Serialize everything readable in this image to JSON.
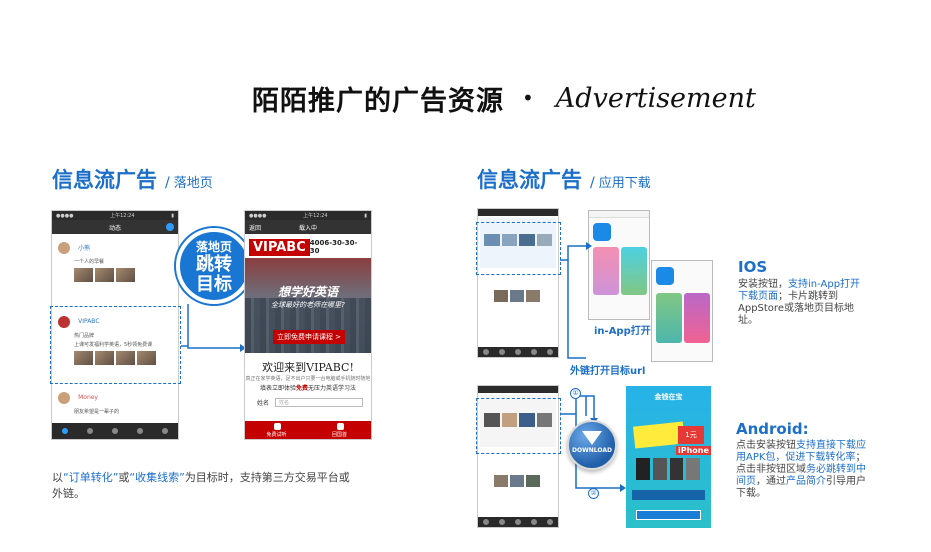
{
  "title": {
    "zh": "陌陌推广的广告资源",
    "dot": "•",
    "en": "Advertisement"
  },
  "left_section": {
    "heading": "信息流广告",
    "slash": "/",
    "subheading": "落地页",
    "badge": {
      "line1": "落地页",
      "line2": "跳转",
      "line3": "目标"
    },
    "feed_phone": {
      "status_time": "上午12:24",
      "nav_label": "动态",
      "item1_name": "小熊",
      "item1_text": "一个人的早餐",
      "ad_name": "VIPABC",
      "ad_sub": "热门品牌",
      "ad_text": "上课可发福利学英语，5秒领免费课",
      "item3_name": "Money",
      "item3_text": "朋友希望是一辈子的"
    },
    "landing_phone": {
      "status_time": "上午12:24",
      "back_label": "返回",
      "nav_title": "载入中",
      "logo": "VIPABC",
      "phone_number": "4006-30-30-30",
      "hero_line1": "想学好英语",
      "hero_line2": "全球最好的老师在哪里?",
      "hero_button": "立即免费申请课程 >",
      "welcome": "欢迎来到VIPABC!",
      "welcome_sub": "真正在家学英语，足不出户只要一台电脑或手机随时随地",
      "desc_prefix": "填表立即体验",
      "desc_highlight": "免费",
      "desc_suffix": "无压力英语学习法",
      "field_label": "姓名",
      "field_placeholder": "姓名",
      "footer_left": "免费试听",
      "footer_right": "回国首"
    },
    "caption": {
      "prefix": "以",
      "hl1": "“订单转化”",
      "mid": "或",
      "hl2": "“收集线索”",
      "suffix": "为目标时，支持第三方交易平台或外链。"
    }
  },
  "right_section": {
    "heading": "信息流广告",
    "slash": "/",
    "subheading": "应用下载",
    "inapp_label": "in-App打开",
    "external_label": "外链打开目标url",
    "ios": {
      "title": "IOS",
      "text_a": "安装按钮，",
      "text_hl": "支持in-App打开下载页面",
      "text_b": "；卡片跳转到AppStore或落地页目标地址。"
    },
    "android": {
      "title": "Android:",
      "text_a": "点击安装按钮",
      "text_hl1": "支持直接下载应用APK包，促进下载转化率",
      "text_b": "；点击非按钮区域",
      "text_hl2": "务必跳转到中间页",
      "text_c": "，通过",
      "text_hl3": "产品简介",
      "text_d": "引导用户下载。"
    },
    "download_label": "DOWNLOAD",
    "step1": "①",
    "step2": "②",
    "promo": {
      "title": "金钱在宝",
      "badge": "iPhone",
      "price": "1元"
    }
  },
  "colors": {
    "accent": "#1c6fc8",
    "brand_red": "#c40000",
    "badge_blue": "#1976d2"
  }
}
